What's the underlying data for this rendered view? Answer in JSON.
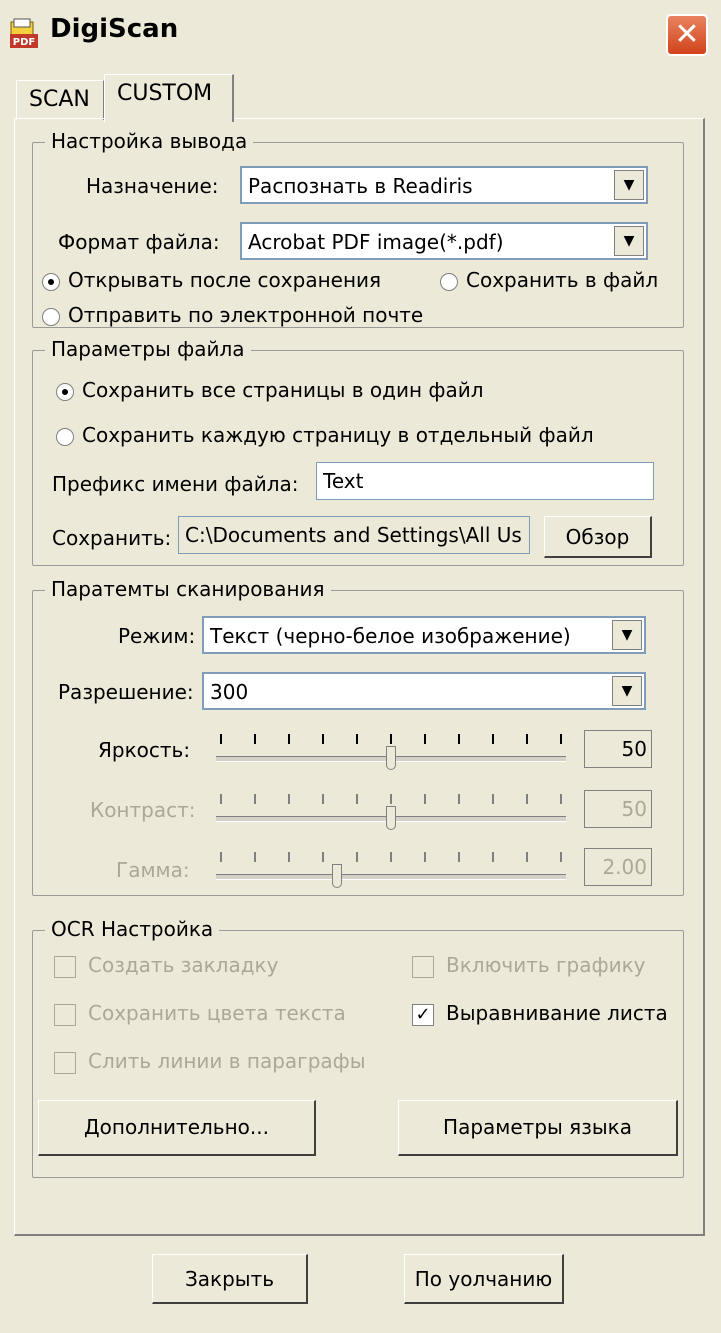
{
  "window": {
    "title": "DigiScan",
    "icon": "pdf-app-icon"
  },
  "tabs": [
    {
      "label": "SCAN"
    },
    {
      "label": "CUSTOM"
    }
  ],
  "output": {
    "title": "Настройка вывода",
    "destination_label": "Назначение:",
    "destination_value": "Распознать в Readiris",
    "format_label": "Формат файла:",
    "format_value": "Acrobat PDF image(*.pdf)",
    "radio_open": "Открывать после сохранения",
    "radio_save": "Сохранить в файл",
    "radio_email": "Отправить по электронной почте"
  },
  "file": {
    "title": "Параметры файла",
    "radio_all": "Сохранить все страницы в один файл",
    "radio_each": "Сохранить каждую страницу в отдельный файл",
    "prefix_label": "Префикс имени файла:",
    "prefix_value": "Text",
    "save_label": "Сохранить:",
    "save_path": "C:\\Documents and Settings\\All Us",
    "browse_label": "Обзор"
  },
  "scan": {
    "title": "Паратемты сканирования",
    "mode_label": "Режим:",
    "mode_value": "Текст (черно-белое изображение)",
    "resolution_label": "Разрешение:",
    "resolution_value": "300",
    "brightness_label": "Яркость:",
    "brightness_value": "50",
    "brightness_level": 0.5,
    "contrast_label": "Контраст:",
    "contrast_value": "50",
    "contrast_level": 0.5,
    "gamma_label": "Гамма:",
    "gamma_value": "2.00",
    "gamma_level": 0.34
  },
  "ocr": {
    "title": "OCR Настройка",
    "bookmark": "Создать закладку",
    "graphics": "Включить графику",
    "text_colors": "Сохранить цвета текста",
    "deskew": "Выравнивание листа",
    "merge_lines": "Слить линии в параграфы",
    "advanced_button": "Дополнительно...",
    "language_button": "Параметры языка"
  },
  "footer": {
    "close_button": "Закрыть",
    "default_button": "По уолчанию"
  },
  "colors": {
    "close_button_bg": "#d2431b",
    "dialog_bg": "#ece9d8"
  }
}
